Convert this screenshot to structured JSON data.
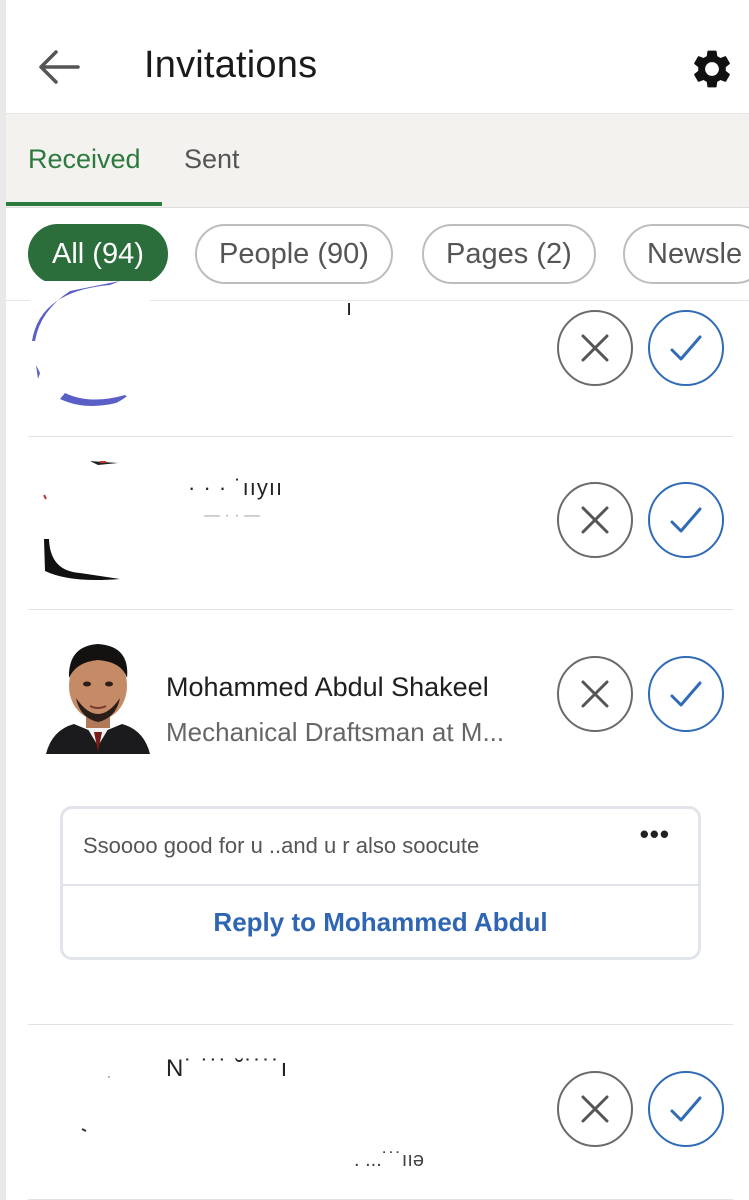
{
  "header": {
    "back_icon": "arrow-left-icon",
    "title": "Invitations",
    "settings_icon": "gear-icon"
  },
  "tabs": [
    {
      "label": "Received",
      "active": true
    },
    {
      "label": "Sent",
      "active": false
    }
  ],
  "filters": [
    {
      "label": "All (94)",
      "selected": true
    },
    {
      "label": "People (90)",
      "selected": false
    },
    {
      "label": "Pages (2)",
      "selected": false
    },
    {
      "label": "Newsle",
      "selected": false
    }
  ],
  "invitations": [
    {
      "name": "",
      "headline": "",
      "redacted": true
    },
    {
      "name": "",
      "headline": "",
      "redacted": true
    },
    {
      "name": "Mohammed Abdul Shakeel",
      "headline": "Mechanical Draftsman at M...",
      "message": {
        "text": "Ssoooo  good for u ..and u r also soocute",
        "more_icon": "more-horizontal-icon",
        "reply_label": "Reply to Mohammed Abdul"
      }
    },
    {
      "name": "",
      "headline": "",
      "redacted": true
    }
  ],
  "actions": {
    "ignore_icon": "close-icon",
    "accept_icon": "checkmark-icon"
  },
  "colors": {
    "brand_green": "#2b6e3c",
    "accept_blue": "#2f6bb7",
    "ignore_gray": "#6a6a6a"
  }
}
